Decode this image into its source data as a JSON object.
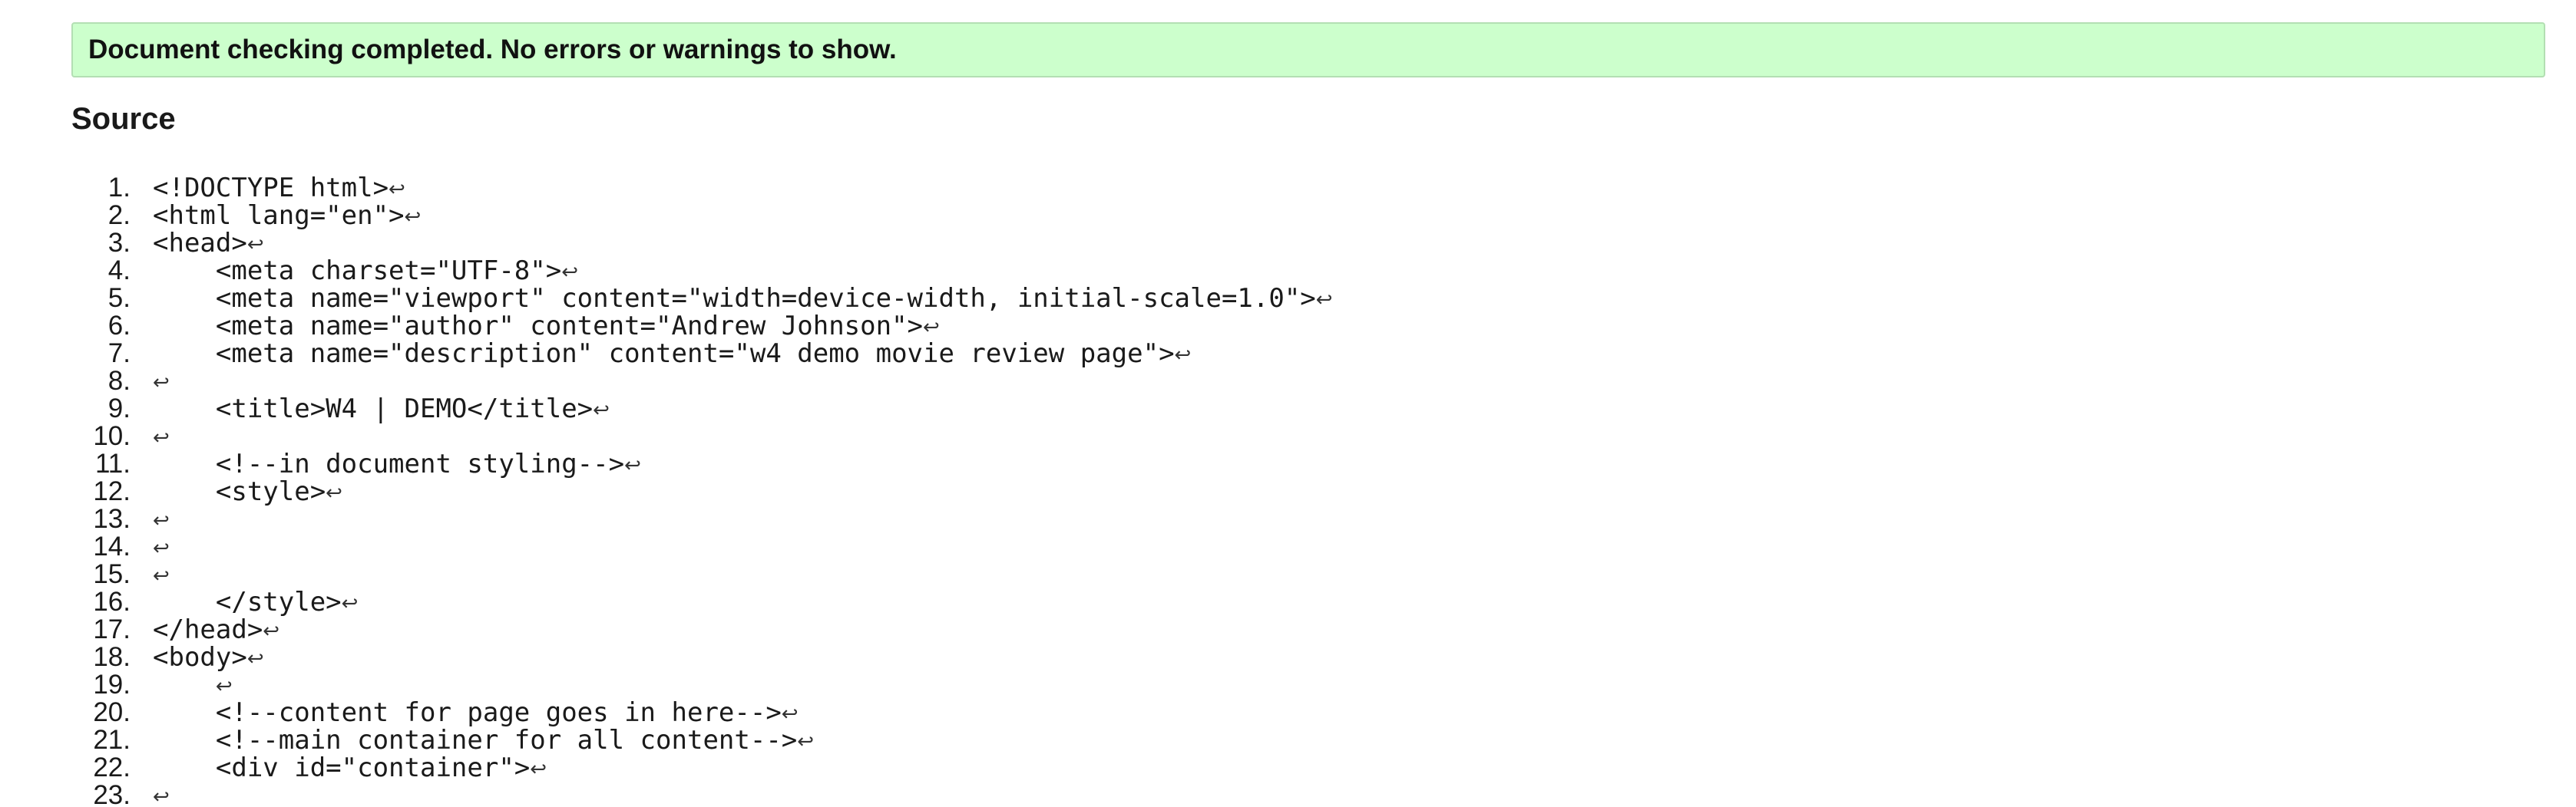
{
  "status": {
    "message": "Document checking completed. No errors or warnings to show."
  },
  "source": {
    "heading": "Source",
    "line_end_icon": "return-arrow-icon",
    "line_end_glyph": "↩",
    "lines": [
      {
        "number": "1.",
        "code": "<!DOCTYPE html>"
      },
      {
        "number": "2.",
        "code": "<html lang=\"en\">"
      },
      {
        "number": "3.",
        "code": "<head>"
      },
      {
        "number": "4.",
        "code": "    <meta charset=\"UTF-8\">"
      },
      {
        "number": "5.",
        "code": "    <meta name=\"viewport\" content=\"width=device-width, initial-scale=1.0\">"
      },
      {
        "number": "6.",
        "code": "    <meta name=\"author\" content=\"Andrew Johnson\">"
      },
      {
        "number": "7.",
        "code": "    <meta name=\"description\" content=\"w4 demo movie review page\">"
      },
      {
        "number": "8.",
        "code": ""
      },
      {
        "number": "9.",
        "code": "    <title>W4 | DEMO</title>"
      },
      {
        "number": "10.",
        "code": ""
      },
      {
        "number": "11.",
        "code": "    <!--in document styling-->"
      },
      {
        "number": "12.",
        "code": "    <style>"
      },
      {
        "number": "13.",
        "code": ""
      },
      {
        "number": "14.",
        "code": ""
      },
      {
        "number": "15.",
        "code": ""
      },
      {
        "number": "16.",
        "code": "    </style>"
      },
      {
        "number": "17.",
        "code": "</head>"
      },
      {
        "number": "18.",
        "code": "<body>"
      },
      {
        "number": "19.",
        "code": "    "
      },
      {
        "number": "20.",
        "code": "    <!--content for page goes in here-->"
      },
      {
        "number": "21.",
        "code": "    <!--main container for all content-->"
      },
      {
        "number": "22.",
        "code": "    <div id=\"container\">"
      },
      {
        "number": "23.",
        "code": ""
      }
    ]
  }
}
